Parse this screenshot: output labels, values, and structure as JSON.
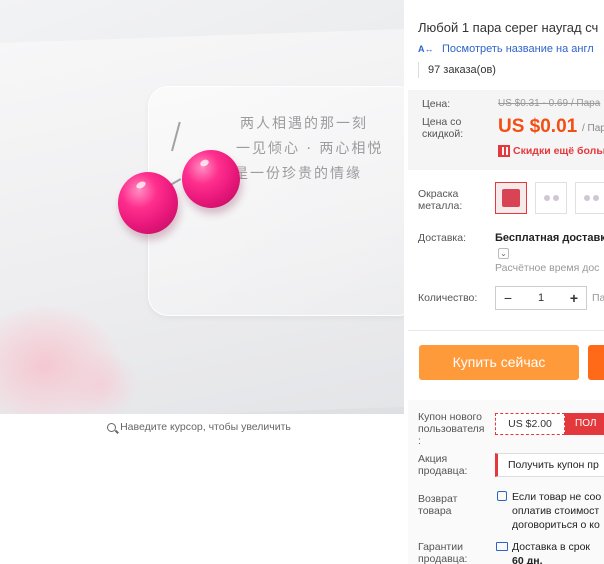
{
  "image": {
    "poem_lines": [
      "两人相遇的那一刻",
      "一见倾心 · 两心相悦",
      "是一份珍贵的情缘"
    ],
    "zoom_hint": "Наведите курсор, чтобы увеличить",
    "earring_color": "#ff2f8e"
  },
  "product": {
    "title": "Любой 1 пара серег наугад сч",
    "translate_link": "Посмотреть название на англ",
    "translate_icon": "A↔",
    "orders": "97 заказа(ов)"
  },
  "price": {
    "label": "Цена:",
    "old": "US $0.31 - 0.69 / Пара",
    "discount_label_line1": "Цена со",
    "discount_label_line2": "скидкой:",
    "current": "US $0.01",
    "per_unit": "/ Пар",
    "discount_link": "Скидки ещё больш",
    "accent_color": "#f34e14"
  },
  "options": {
    "metal_label_line1": "Окраска",
    "metal_label_line2": "металла:",
    "shipping_label": "Доставка:",
    "shipping_value": "Бесплатная доставк",
    "shipping_chevron": "⌄",
    "delivery_estimate": "Расчётное время дос",
    "quantity_label": "Количество:",
    "quantity_minus": "−",
    "quantity_value": "1",
    "quantity_plus": "+",
    "stock_prefix": "Па"
  },
  "actions": {
    "buy_now": "Купить сейчас",
    "buy_color": "#ff9a3a"
  },
  "promo": {
    "new_user_label_line1": "Купон нового",
    "new_user_label_line2": "пользователя",
    "new_user_label_line3": ":",
    "coupon_value": "US $2.00",
    "coupon_get": "ПОЛ",
    "seller_label_line1": "Акция",
    "seller_label_line2": "продавца:",
    "seller_coupon": "Получить купон пр",
    "return_label_line1": "Возврат",
    "return_label_line2": "товара",
    "return_text_line1": "Если товар не соо",
    "return_text_line2": "оплатив стоимост",
    "return_text_line3": "договориться о ко",
    "guarantee_label_line1": "Гарантии",
    "guarantee_label_line2": "продавца:",
    "guarantee_text_line1": "Доставка в срок",
    "guarantee_text_line2": "60 дн."
  }
}
